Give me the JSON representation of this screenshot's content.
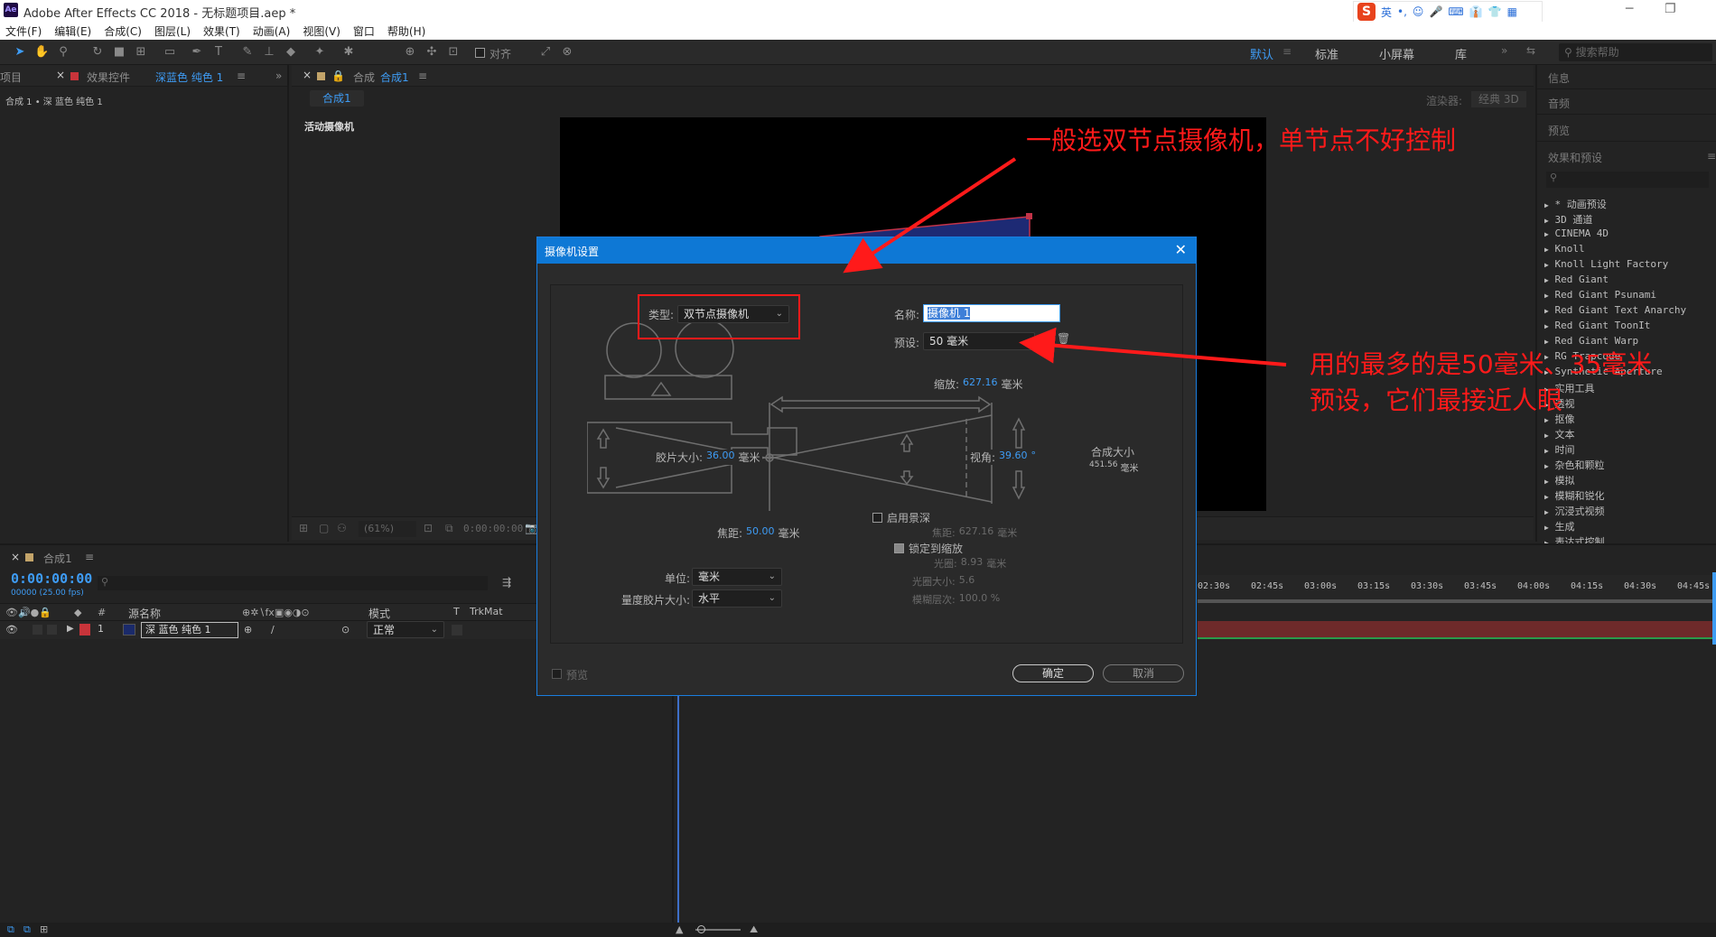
{
  "window": {
    "title": "Adobe After Effects CC 2018 - 无标题项目.aep *",
    "app_badge": "Ae",
    "ime": [
      "英",
      "•,",
      "☺",
      "🎤",
      "⌨",
      "👔",
      "👕",
      "▦"
    ],
    "ime_logo": "S"
  },
  "menu": [
    "文件(F)",
    "编辑(E)",
    "合成(C)",
    "图层(L)",
    "效果(T)",
    "动画(A)",
    "视图(V)",
    "窗口",
    "帮助(H)"
  ],
  "toolbar": {
    "align_label": "对齐",
    "workspaces": [
      "默认",
      "标准",
      "小屏幕",
      "库"
    ],
    "search_placeholder": "搜索帮助"
  },
  "project_panel": {
    "tab_project": "项目",
    "tab_effects": "效果控件",
    "effects_target": "深蓝色 纯色 1",
    "breadcrumb": "合成 1 • 深 蓝色 纯色 1"
  },
  "comp_panel": {
    "tab_label": "合成",
    "tab_name": "合成1",
    "sub_tab": "合成1",
    "renderer_label": "渲染器:",
    "renderer_value": "经典 3D",
    "active_camera": "活动摄像机",
    "zoom": "(61%)",
    "timecode": "0:00:00:00"
  },
  "info_panel": {
    "sections": [
      "信息",
      "音频",
      "预览",
      "效果和预设"
    ],
    "effects_list": [
      "* 动画预设",
      "3D 通道",
      "CINEMA 4D",
      "Knoll",
      "Knoll Light Factory",
      "Red Giant",
      "Red Giant Psunami",
      "Red Giant Text Anarchy",
      "Red Giant ToonIt",
      "Red Giant Warp",
      "RG Trapcode",
      "Synthetic Aperture",
      "实用工具",
      "透视",
      "抠像",
      "文本",
      "时间",
      "杂色和颗粒",
      "模拟",
      "模糊和锐化",
      "沉浸式视频",
      "生成",
      "表达式控制"
    ]
  },
  "dialog": {
    "title": "摄像机设置",
    "type_label": "类型:",
    "type_value": "双节点摄像机",
    "name_label": "名称:",
    "name_value": "摄像机 1",
    "preset_label": "预设:",
    "preset_value": "50 毫米",
    "zoom_label": "缩放:",
    "zoom_value": "627.16",
    "unit_mm": "毫米",
    "film_label": "胶片大小:",
    "film_value": "36.00",
    "angle_label": "视角:",
    "angle_value": "39.60",
    "angle_unit": "°",
    "comp_size_label": "合成大小",
    "comp_size_value": "451.56",
    "dof_label": "启用景深",
    "focus_label": "焦距:",
    "focus_value": "50.00",
    "focus_dist_label": "焦距:",
    "focus_dist_value": "627.16",
    "lock_label": "锁定到缩放",
    "aperture_label": "光圈:",
    "aperture_value": "8.93",
    "fstop_label": "光圈大小:",
    "fstop_value": "5.6",
    "blur_label": "模糊层次:",
    "blur_value": "100.0 %",
    "units_label": "单位:",
    "units_value": "毫米",
    "measure_label": "量度胶片大小:",
    "measure_value": "水平",
    "preview_label": "预览",
    "ok_label": "确定",
    "cancel_label": "取消"
  },
  "timeline": {
    "tab": "合成1",
    "timecode": "0:00:00:00",
    "sub": "00000 (25.00 fps)",
    "col_source": "源名称",
    "col_mode": "模式",
    "col_t": "T",
    "col_trkmat": "TrkMat",
    "layer_num": "1",
    "layer_name": "深 蓝色 纯色 1",
    "layer_mode": "正常",
    "ruler": [
      "02:30s",
      "02:45s",
      "03:00s",
      "03:15s",
      "03:30s",
      "03:45s",
      "04:00s",
      "04:15s",
      "04:30s",
      "04:45s"
    ]
  },
  "annotations": {
    "top": "一般选双节点摄像机，单节点不好控制",
    "right_line1": "用的最多的是50毫米、35毫米",
    "right_line2": "预设，它们最接近人眼"
  }
}
